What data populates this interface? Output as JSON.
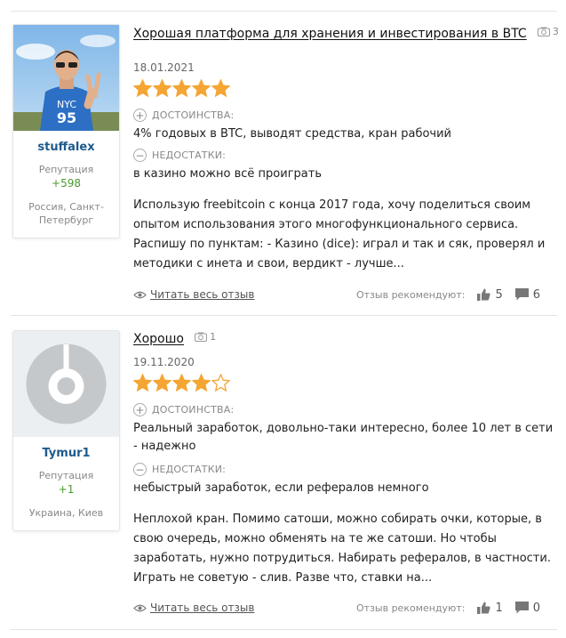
{
  "reviews": [
    {
      "user": {
        "name": "stuffalex",
        "rep_label": "Репутация",
        "rep": "+598",
        "location": "Россия, Санкт-Петербург"
      },
      "title": "Хорошая платформа для хранения и инвестирования в BTC",
      "photo_count": "3",
      "date": "18.01.2021",
      "rating": 5,
      "pros_label": "ДОСТОИНСТВА:",
      "pros": "4% годовых в BTC, выводят средства, кран рабочий",
      "cons_label": "НЕДОСТАТКИ:",
      "cons": "в казино можно всё проиграть",
      "body": "Использую freebitcoin с конца 2017 года, хочу поделиться своим опытом использования этого многофункционального сервиса. Распишу по пунктам: - Казино (dice): играл и так и сяк, проверял и методики с инета и свои, вердикт - лучше...",
      "read_all": "Читать весь отзыв",
      "recommend_label": "Отзыв рекомендуют:",
      "likes": "5",
      "comments": "6"
    },
    {
      "user": {
        "name": "Tymur1",
        "rep_label": "Репутация",
        "rep": "+1",
        "location": "Украина, Киев"
      },
      "title": "Хорошо",
      "photo_count": "1",
      "date": "19.11.2020",
      "rating": 4,
      "pros_label": "ДОСТОИНСТВА:",
      "pros": "Реальный заработок, довольно-таки интересно, более 10 лет в сети - надежно",
      "cons_label": "НЕДОСТАТКИ:",
      "cons": "небыстрый заработок, если рефералов немного",
      "body": "Неплохой кран. Помимо сатоши, можно собирать очки, которые, в свою очередь, можно обменять на те же сатоши. Но чтобы заработать, нужно потрудиться. Набирать рефералов, в частности. Играть не советую - слив. Разве что, ставки на...",
      "read_all": "Читать весь отзыв",
      "recommend_label": "Отзыв рекомендуют:",
      "likes": "1",
      "comments": "0"
    }
  ],
  "colors": {
    "star": "#f4a532",
    "username": "#1e5a8c",
    "reputation": "#4a9a2f"
  }
}
